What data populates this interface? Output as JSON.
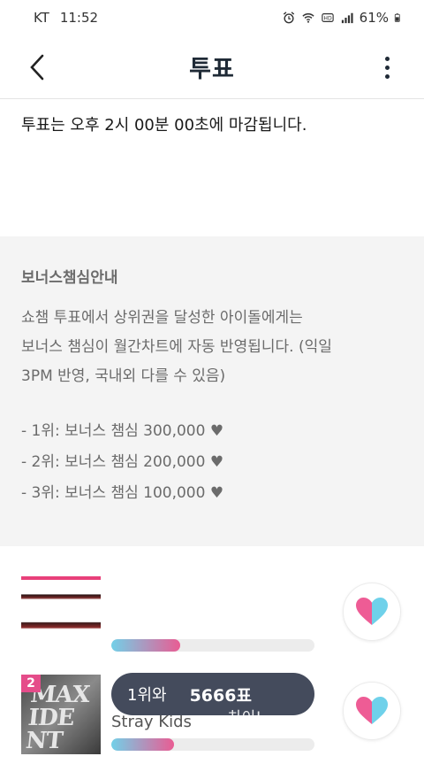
{
  "status_bar": {
    "carrier": "KT",
    "time": "11:52",
    "battery": "61%"
  },
  "header": {
    "title": "투표"
  },
  "notice": "투표는 오후 2시 00분 00초에 마감됩니다.",
  "bonus_info": {
    "title": "보너스챔심안내",
    "body_lines": [
      "쇼챔 투표에서 상위권을 달성한 아이돌에게는",
      "보너스 챔심이 월간차트에 자동 반영됩니다. (익일",
      "3PM 반영, 국내외 다를 수 있음)"
    ],
    "ranks": [
      "- 1위: 보너스 챔심 300,000 ♥",
      "- 2위: 보너스 챔심 200,000 ♥",
      "- 3위: 보너스 챔심 100,000 ♥"
    ]
  },
  "vote_rows": [
    {
      "rank": "",
      "artist": "",
      "progress": 0.34
    },
    {
      "rank": "2",
      "album_text": "MAXIDENT",
      "artist": "Stray Kids",
      "progress": 0.31,
      "tooltip": {
        "label": "1위와",
        "gap": "5666표",
        "tail": "차이!"
      }
    }
  ],
  "colors": {
    "accent_pink": "#e95c93",
    "accent_cyan": "#72d0e8",
    "tooltip_bg": "#444b5c",
    "info_bg": "#f4f4f4"
  },
  "icons": {
    "back": "chevron-left-icon",
    "more": "more-vertical-icon",
    "vote": "heart-icon"
  }
}
